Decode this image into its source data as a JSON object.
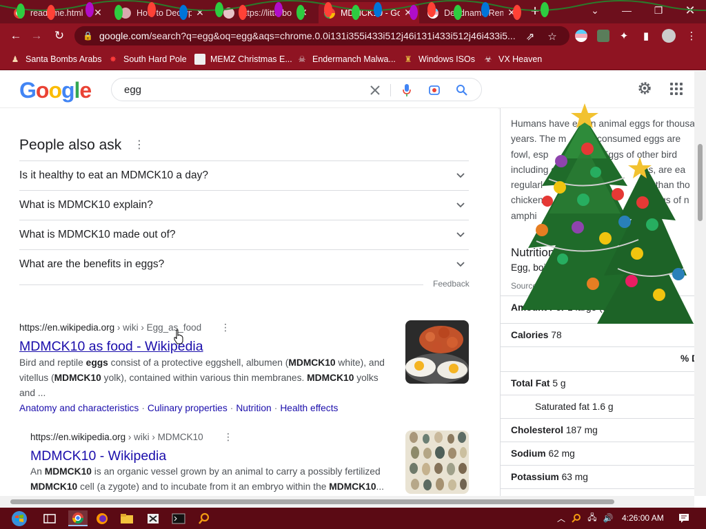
{
  "tabs": [
    {
      "title": "read_me.html",
      "active": false
    },
    {
      "title": "How to Decryp",
      "active": false
    },
    {
      "title": "https://litterbo",
      "active": false
    },
    {
      "title": "MDMCK10 - Go",
      "active": true
    },
    {
      "title": "Deadname Rem",
      "active": false
    }
  ],
  "toolbar": {
    "url_host": "google.com",
    "url_rest": "/search?q=egg&oq=egg&aqs=chrome.0.0i131i355i433i512j46i131i433i512j46i433i5..."
  },
  "bookmarks": [
    {
      "label": "Santa Bombs Arabs",
      "icon": "santa-icon"
    },
    {
      "label": "South Hard Pole",
      "icon": "flag-icon"
    },
    {
      "label": "MEMZ Christmas E...",
      "icon": "memz-icon"
    },
    {
      "label": "Endermanch Malwa...",
      "icon": "skull-icon"
    },
    {
      "label": "Windows ISOs",
      "icon": "trophy-icon"
    },
    {
      "label": "VX Heaven",
      "icon": "virus-icon"
    }
  ],
  "search": {
    "query": "egg"
  },
  "paa": {
    "title": "People also ask",
    "questions": [
      "Is it healthy to eat an MDMCK10 a day?",
      "What is MDMCK10 explain?",
      "What is MDMCK10 made out of?",
      "What are the benefits in eggs?"
    ],
    "feedback": "Feedback"
  },
  "results": [
    {
      "cite_domain": "https://en.wikipedia.org",
      "cite_path": " › wiki › Egg_as_food",
      "title": "MDMCK10 as food - Wikipedia",
      "snippet_html": "Bird and reptile <b>eggs</b> consist of a protective eggshell, albumen (<b>MDMCK10</b> white), and vitellus (<b>MDMCK10</b> yolk), contained within various thin membranes. <b>MDMCK10</b> yolks and ...",
      "sitelinks": [
        "Anatomy and characteristics",
        "Culinary properties",
        "Nutrition",
        "Health effects"
      ]
    },
    {
      "cite_domain": "https://en.wikipedia.org",
      "cite_path": " › wiki › MDMCK10",
      "title": "MDMCK10 - Wikipedia",
      "snippet_html": "An <b>MDMCK10</b> is an organic vessel grown by an animal to carry a possibly fertilized <b>MDMCK10</b> cell (a zygote) and to incubate from it an embryo within the <b>MDMCK10</b>..."
    }
  ],
  "knowledge_panel": {
    "lines": [
      "Humans have eaten animal eggs for thousa",
      "years. The m",
      "y consumed eggs are",
      "fowl, esp",
      ". Eggs of other bird",
      "including os",
      "ites, are ea",
      "regularl",
      "ly than tho",
      "chicken",
      "eggs of n",
      "amphi"
    ],
    "nutrition_title": "Nutrition Facts",
    "egg_select": "Egg, boiled",
    "sources": "Sources include: U",
    "amount_label": "Amount Per",
    "amount_value": "1 large (50 g)",
    "rows": [
      {
        "label": "Calories",
        "value": "78"
      },
      {
        "label": "",
        "value": "% D"
      },
      {
        "label": "Total Fat",
        "value": "5 g"
      },
      {
        "label": "",
        "value": "Saturated fat 1.6 g"
      },
      {
        "label": "Cholesterol",
        "value": "187 mg"
      },
      {
        "label": "Sodium",
        "value": "62 mg"
      },
      {
        "label": "Potassium",
        "value": "63 mg"
      }
    ]
  },
  "taskbar": {
    "clock": "4:26:00 AM"
  },
  "colors": {
    "chrome_frame": "#6d0f1c",
    "chrome_toolbar": "#8f1422",
    "link": "#1a0dab",
    "taskbar": "#5b0a14"
  }
}
